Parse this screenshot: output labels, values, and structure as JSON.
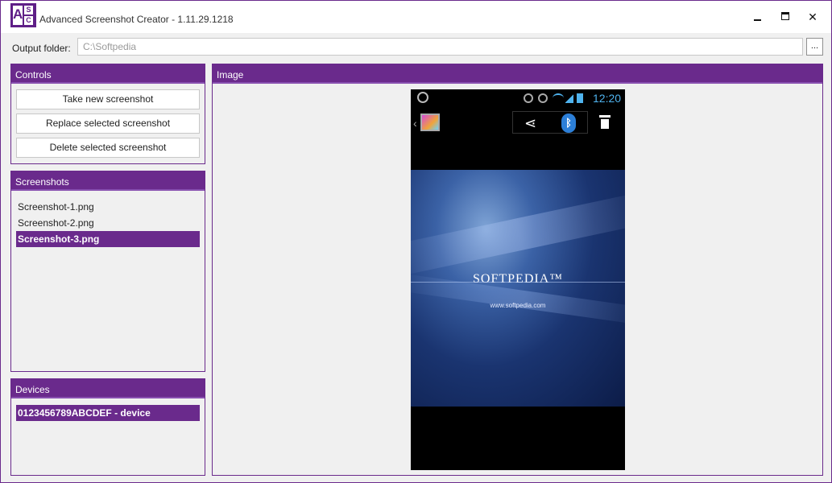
{
  "window": {
    "title": "Advanced Screenshot Creator - 1.11.29.1218",
    "icon_letters": [
      "A",
      "S",
      "C"
    ],
    "minimize_icon": "minimize-icon",
    "maximize_icon": "maximize-icon",
    "close_glyph": "✕"
  },
  "output_folder": {
    "label": "Output folder:",
    "value": "C:\\Softpedia",
    "browse_label": "..."
  },
  "controls": {
    "header": "Controls",
    "take_label": "Take new screenshot",
    "replace_label": "Replace selected screenshot",
    "delete_label": "Delete selected screenshot"
  },
  "screenshots": {
    "header": "Screenshots",
    "items": [
      {
        "label": "Screenshot-1.png",
        "selected": false
      },
      {
        "label": "Screenshot-2.png",
        "selected": false
      },
      {
        "label": "Screenshot-3.png",
        "selected": true
      }
    ]
  },
  "devices": {
    "header": "Devices",
    "items": [
      {
        "label": "0123456789ABCDEF - device",
        "selected": true
      }
    ]
  },
  "image_panel": {
    "header": "Image",
    "phone": {
      "clock": "12:20",
      "bluetooth_glyph": "ᛒ",
      "share_glyph": "⋖",
      "back_glyph": "‹",
      "wallpaper_title": "SOFTPEDIA™",
      "wallpaper_url": "www.softpedia.com"
    }
  },
  "colors": {
    "accent": "#6a2a8c",
    "clock_blue": "#4fb3ee",
    "bluetooth_blue": "#2c7fd8"
  }
}
